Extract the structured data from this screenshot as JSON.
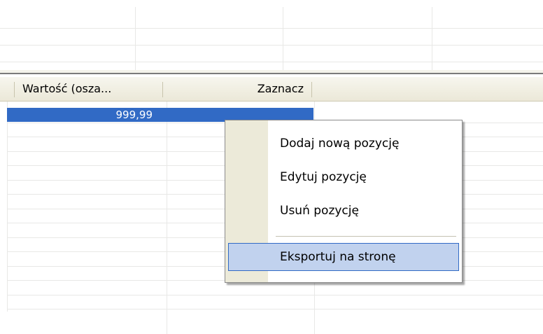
{
  "grid": {
    "columns": [
      {
        "header": "Wartość (osza..."
      },
      {
        "header": "Zaznacz"
      }
    ],
    "selected_row": {
      "value": "999,99",
      "zaznacz": ""
    }
  },
  "context_menu": {
    "items": [
      {
        "label": "Dodaj nową pozycję"
      },
      {
        "label": "Edytuj pozycję"
      },
      {
        "label": "Usuń pozycję"
      }
    ],
    "highlighted_item": {
      "label": "Eksportuj na stronę"
    }
  },
  "colors": {
    "selection": "#316ac5",
    "header_bg": "#ece9d8",
    "menu_highlight": "#c1d2ee"
  }
}
